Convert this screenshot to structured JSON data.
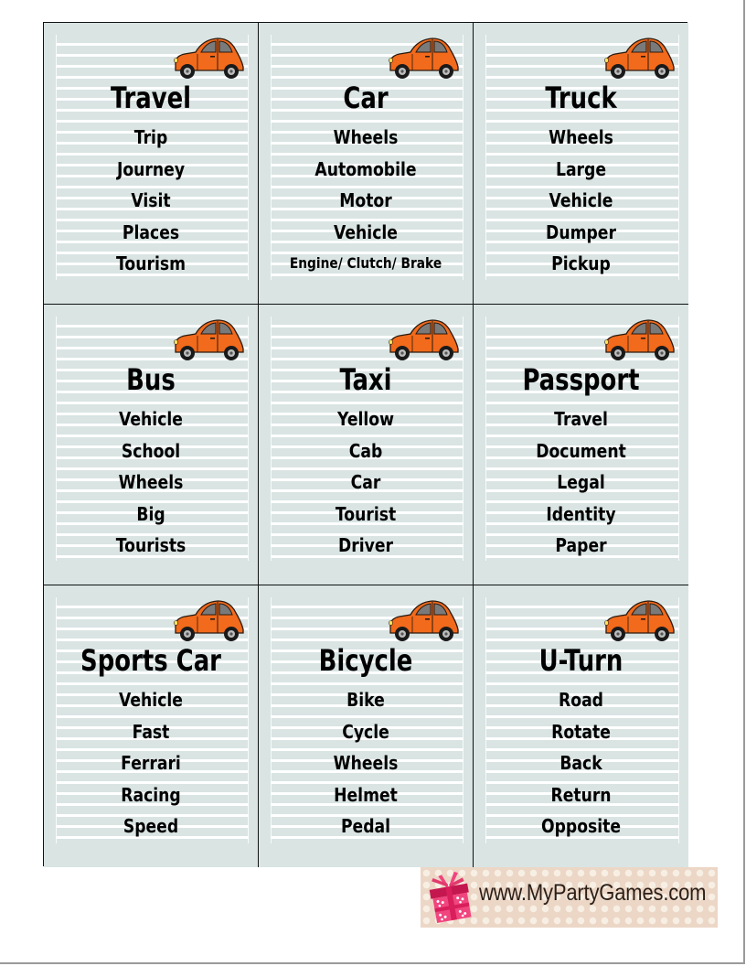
{
  "cards": [
    {
      "title": "Travel",
      "words": [
        "Trip",
        "Journey",
        "Visit",
        "Places",
        "Tourism"
      ]
    },
    {
      "title": "Car",
      "words": [
        "Wheels",
        "Automobile",
        "Motor",
        "Vehicle",
        "Engine/ Clutch/ Brake"
      ]
    },
    {
      "title": "Truck",
      "words": [
        "Wheels",
        "Large",
        "Vehicle",
        "Dumper",
        "Pickup"
      ]
    },
    {
      "title": "Bus",
      "words": [
        "Vehicle",
        "School",
        "Wheels",
        "Big",
        "Tourists"
      ]
    },
    {
      "title": "Taxi",
      "words": [
        "Yellow",
        "Cab",
        "Car",
        "Tourist",
        "Driver"
      ]
    },
    {
      "title": "Passport",
      "words": [
        "Travel",
        "Document",
        "Legal",
        "Identity",
        "Paper"
      ]
    },
    {
      "title": "Sports Car",
      "words": [
        "Vehicle",
        "Fast",
        "Ferrari",
        "Racing",
        "Speed"
      ]
    },
    {
      "title": "Bicycle",
      "words": [
        "Bike",
        "Cycle",
        "Wheels",
        "Helmet",
        "Pedal"
      ]
    },
    {
      "title": "U-Turn",
      "words": [
        "Road",
        "Rotate",
        "Back",
        "Return",
        "Opposite"
      ]
    }
  ],
  "card_icon": "orange-car-icon",
  "footer": {
    "site": "www.MyPartyGames.com",
    "logo_icon": "gift-box-icon"
  },
  "colors": {
    "card_background": "#d9e4e3",
    "stripe": "#ffffff",
    "car_body": "#f26a1b",
    "banner_background": "#ecd6c6",
    "gift_pink": "#f0457e"
  }
}
